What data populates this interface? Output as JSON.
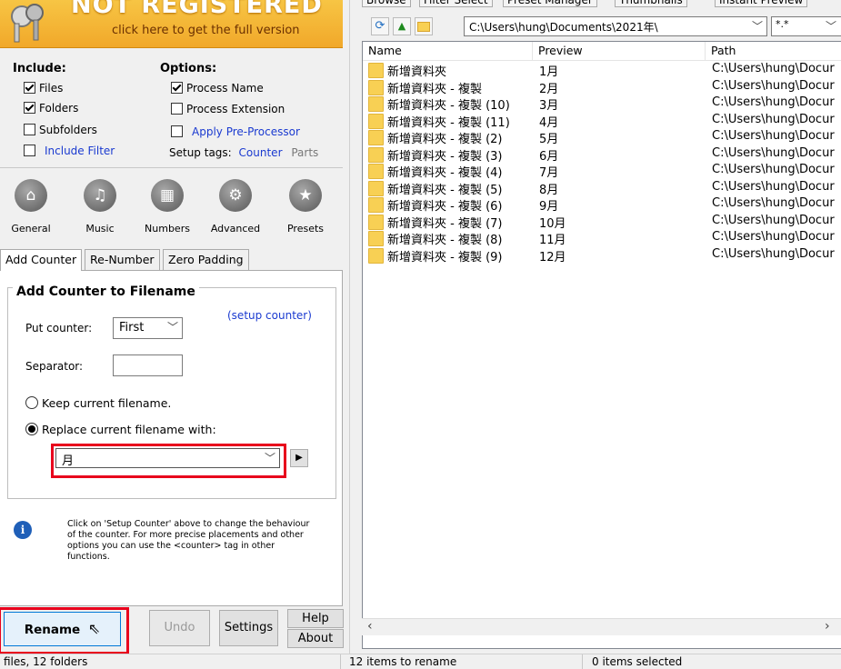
{
  "banner": {
    "title": "NOT REGISTERED",
    "subtitle": "click here to get the full version"
  },
  "include": {
    "heading": "Include:",
    "items": [
      {
        "label": "Files",
        "checked": true
      },
      {
        "label": "Folders",
        "checked": true
      },
      {
        "label": "Subfolders",
        "checked": false
      },
      {
        "label": "Include Filter",
        "checked": false
      }
    ]
  },
  "options": {
    "heading": "Options:",
    "items": [
      {
        "label": "Process Name",
        "checked": true
      },
      {
        "label": "Process Extension",
        "checked": false
      },
      {
        "label": "Apply Pre-Processor",
        "checked": false
      }
    ],
    "setup_tags_label": "Setup tags:",
    "setup_tags_counter": "Counter",
    "setup_tags_parts": "Parts"
  },
  "categories": [
    {
      "label": "General",
      "icon": "home-icon"
    },
    {
      "label": "Music",
      "icon": "music-icon"
    },
    {
      "label": "Numbers",
      "icon": "calculator-icon"
    },
    {
      "label": "Advanced",
      "icon": "gear-icon"
    },
    {
      "label": "Presets",
      "icon": "star-icon"
    }
  ],
  "tabs": [
    "Add Counter",
    "Re-Number",
    "Zero Padding"
  ],
  "counter": {
    "group_title": "Add Counter to Filename",
    "setup_link": "(setup counter)",
    "put_counter_label": "Put counter:",
    "put_counter_value": "First",
    "separator_label": "Separator:",
    "separator_value": "",
    "keep_label": "Keep current filename.",
    "replace_label": "Replace current filename with:",
    "replace_value": "月",
    "selected_option": "replace"
  },
  "info_text": "Click on 'Setup Counter' above to change the behaviour of the counter. For more precise placements and other options you can use the <counter> tag in other functions.",
  "buttons": {
    "rename": "Rename",
    "undo": "Undo",
    "settings": "Settings",
    "help": "Help",
    "about": "About"
  },
  "status": {
    "left": "files, 12 folders",
    "middle": "12 items to rename",
    "right": "0 items selected"
  },
  "right_tabs": [
    "Browse",
    "Filter Select",
    "Preset Manager",
    "Thumbnails",
    "Instant Preview"
  ],
  "path_value": "C:\\Users\\hung\\Documents\\2021年\\",
  "filter_value": "*.*",
  "file_list": {
    "columns": [
      "Name",
      "Preview",
      "Path"
    ],
    "rows": [
      {
        "name": "新增資料夾",
        "preview": "1月",
        "path": "C:\\Users\\hung\\Docur"
      },
      {
        "name": "新增資料夾 - 複製",
        "preview": "2月",
        "path": "C:\\Users\\hung\\Docur"
      },
      {
        "name": "新增資料夾 - 複製 (10)",
        "preview": "3月",
        "path": "C:\\Users\\hung\\Docur"
      },
      {
        "name": "新增資料夾 - 複製 (11)",
        "preview": "4月",
        "path": "C:\\Users\\hung\\Docur"
      },
      {
        "name": "新增資料夾 - 複製 (2)",
        "preview": "5月",
        "path": "C:\\Users\\hung\\Docur"
      },
      {
        "name": "新增資料夾 - 複製 (3)",
        "preview": "6月",
        "path": "C:\\Users\\hung\\Docur"
      },
      {
        "name": "新增資料夾 - 複製 (4)",
        "preview": "7月",
        "path": "C:\\Users\\hung\\Docur"
      },
      {
        "name": "新增資料夾 - 複製 (5)",
        "preview": "8月",
        "path": "C:\\Users\\hung\\Docur"
      },
      {
        "name": "新增資料夾 - 複製 (6)",
        "preview": "9月",
        "path": "C:\\Users\\hung\\Docur"
      },
      {
        "name": "新增資料夾 - 複製 (7)",
        "preview": "10月",
        "path": "C:\\Users\\hung\\Docur"
      },
      {
        "name": "新增資料夾 - 複製 (8)",
        "preview": "11月",
        "path": "C:\\Users\\hung\\Docur"
      },
      {
        "name": "新增資料夾 - 複製 (9)",
        "preview": "12月",
        "path": "C:\\Users\\hung\\Docur"
      }
    ]
  },
  "colors": {
    "banner": "#f1a82a",
    "highlight": "#e8001c",
    "link": "#1a3ad0"
  }
}
